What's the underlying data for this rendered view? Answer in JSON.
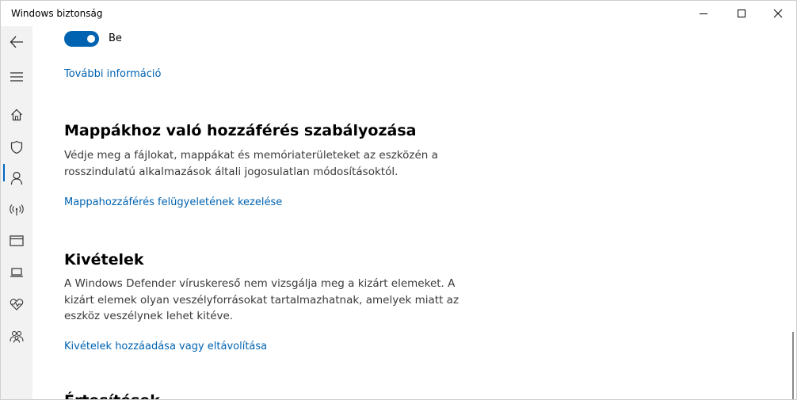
{
  "window": {
    "title": "Windows biztonság",
    "controls": {
      "minimize": "minimize",
      "maximize": "maximize",
      "close": "close"
    }
  },
  "sidebar": {
    "items": [
      {
        "icon": "back-arrow-icon",
        "label": ""
      },
      {
        "icon": "hamburger-menu-icon",
        "label": ""
      },
      {
        "icon": "home-icon",
        "label": ""
      },
      {
        "icon": "shield-icon",
        "label": "",
        "active": true
      },
      {
        "icon": "person-icon",
        "label": ""
      },
      {
        "icon": "wifi-antenna-icon",
        "label": ""
      },
      {
        "icon": "app-browser-icon",
        "label": ""
      },
      {
        "icon": "laptop-icon",
        "label": ""
      },
      {
        "icon": "heart-pulse-icon",
        "label": ""
      },
      {
        "icon": "family-icon",
        "label": ""
      }
    ],
    "active_color": "#0067c0"
  },
  "main": {
    "toggle": {
      "state": "on",
      "label": "Be",
      "color": "#0063b1"
    },
    "more_info_link": "További információ",
    "sections": [
      {
        "heading": "Mappákhoz való hozzáférés szabályozása",
        "description_lines": [
          "Védje meg a fájlokat, mappákat és memóriaterületeket az eszközén a",
          "rosszindulatú alkalmazások általi jogosulatlan módosításoktól."
        ],
        "link": "Mappahozzáférés felügyeletének kezelése"
      },
      {
        "heading": "Kivételek",
        "description_lines": [
          "A Windows Defender víruskereső nem vizsgálja meg a kizárt elemeket. A",
          "kizárt elemek olyan veszélyforrásokat tartalmazhatnak, amelyek miatt az",
          "eszköz veszélynek lehet kitéve."
        ],
        "link": "Kivételek hozzáadása vagy eltávolítása"
      }
    ],
    "partial_heading": "Értesítések",
    "link_color": "#0063b1"
  }
}
